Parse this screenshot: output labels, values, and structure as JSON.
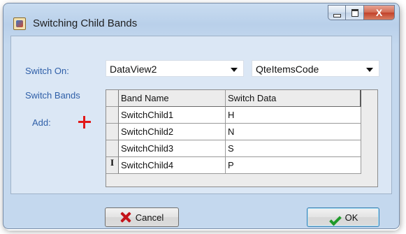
{
  "window": {
    "title": "Switching Child Bands",
    "minimize_glyph": "",
    "close_glyph": "X"
  },
  "form": {
    "switch_on_label": "Switch On:",
    "switch_on_value": "DataView2",
    "switch_field_value": "QteItemsCode",
    "switch_bands_label": "Switch Bands",
    "add_label": "Add:"
  },
  "grid": {
    "columns": [
      "Band Name",
      "Switch Data"
    ],
    "rows": [
      {
        "indicator": "",
        "band": "SwitchChild1",
        "data": "H"
      },
      {
        "indicator": "",
        "band": "SwitchChild2",
        "data": "N"
      },
      {
        "indicator": "",
        "band": "SwitchChild3",
        "data": "S"
      },
      {
        "indicator": "I",
        "band": "SwitchChild4",
        "data": "P"
      }
    ]
  },
  "buttons": {
    "cancel": "Cancel",
    "ok": "OK"
  },
  "icons": {
    "app": "app-icon",
    "add": "plus-icon",
    "cancel": "x-icon",
    "ok": "check-icon"
  },
  "colors": {
    "label": "#2f5fa8",
    "add": "#e21818",
    "cancel_icon": "#c4141b",
    "ok_icon": "#1f9a2a"
  }
}
